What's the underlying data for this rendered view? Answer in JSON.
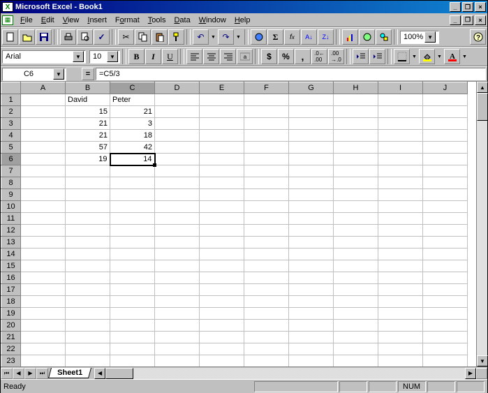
{
  "window": {
    "title": "Microsoft Excel - Book1"
  },
  "menu": {
    "file": "File",
    "edit": "Edit",
    "view": "View",
    "insert": "Insert",
    "format": "Format",
    "tools": "Tools",
    "data": "Data",
    "window": "Window",
    "help": "Help"
  },
  "toolbar": {
    "zoom": "100%"
  },
  "format": {
    "font": "Arial",
    "size": "10"
  },
  "namebox": {
    "ref": "C6"
  },
  "formula": {
    "value": "=C5/3"
  },
  "columns": [
    "A",
    "B",
    "C",
    "D",
    "E",
    "F",
    "G",
    "H",
    "I",
    "J"
  ],
  "rows": [
    "1",
    "2",
    "3",
    "4",
    "5",
    "6",
    "7",
    "8",
    "9",
    "10",
    "11",
    "12",
    "13",
    "14",
    "15",
    "16",
    "17",
    "18",
    "19",
    "20",
    "21",
    "22",
    "23"
  ],
  "cells": {
    "B1": "David",
    "C1": "Peter",
    "B2": "15",
    "C2": "21",
    "B3": "21",
    "C3": "3",
    "B4": "21",
    "C4": "18",
    "B5": "57",
    "C5": "42",
    "B6": "19",
    "C6": "14"
  },
  "activeCell": "C6",
  "activeRow": "6",
  "activeCol": "C",
  "tabs": {
    "sheet1": "Sheet1"
  },
  "status": {
    "ready": "Ready",
    "num": "NUM"
  }
}
